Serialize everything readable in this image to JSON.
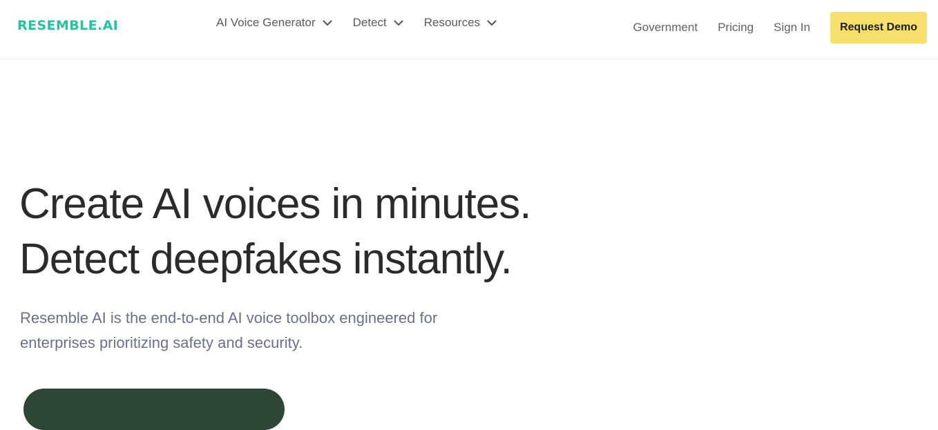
{
  "header": {
    "logo": "RESEMBLE.AI",
    "nav_left": [
      {
        "label": "AI Voice Generator"
      },
      {
        "label": "Detect"
      },
      {
        "label": "Resources"
      }
    ],
    "nav_right": [
      {
        "label": "Government"
      },
      {
        "label": "Pricing"
      },
      {
        "label": "Sign In"
      }
    ],
    "cta_label": "Request Demo"
  },
  "hero": {
    "title_line1": "Create AI voices in minutes.",
    "title_line2": "Detect deepfakes instantly.",
    "subtitle": "Resemble AI is the end-to-end AI voice toolbox engineered for enterprises prioritizing safety and security."
  },
  "colors": {
    "brand": "#23c2a0",
    "cta_yellow": "#f6df6a",
    "cta_dark_green": "#2e4636"
  }
}
